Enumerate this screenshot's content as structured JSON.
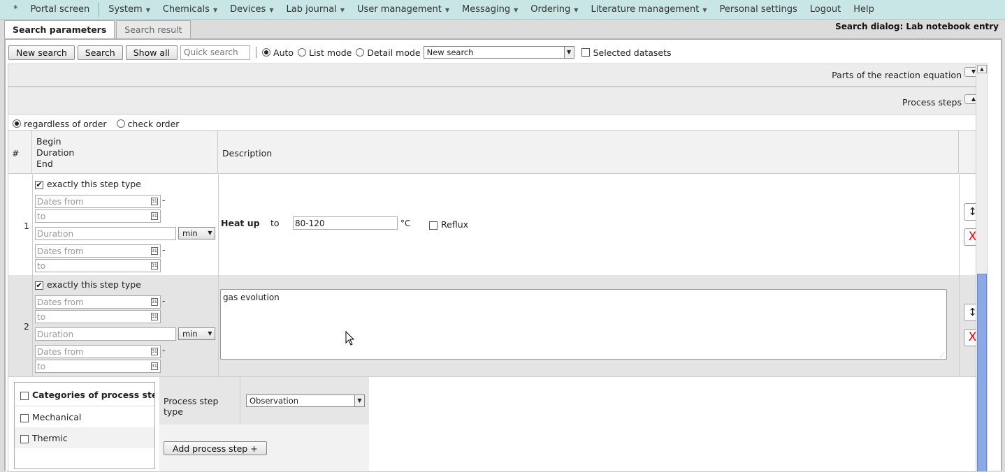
{
  "menu": {
    "items": [
      {
        "label": "*",
        "dropdown": false
      },
      {
        "label": "Portal screen",
        "dropdown": false
      },
      {
        "label": "System",
        "dropdown": true
      },
      {
        "label": "Chemicals",
        "dropdown": true
      },
      {
        "label": "Devices",
        "dropdown": true
      },
      {
        "label": "Lab journal",
        "dropdown": true
      },
      {
        "label": "User management",
        "dropdown": true
      },
      {
        "label": "Messaging",
        "dropdown": true
      },
      {
        "label": "Ordering",
        "dropdown": true
      },
      {
        "label": "Literature management",
        "dropdown": true
      },
      {
        "label": "Personal settings",
        "dropdown": false
      },
      {
        "label": "Logout",
        "dropdown": false
      },
      {
        "label": "Help",
        "dropdown": false
      }
    ]
  },
  "tabs": {
    "active": "Search parameters",
    "inactive": "Search result"
  },
  "dialog_title": "Search dialog: Lab notebook entry",
  "toolbar": {
    "new_search": "New search",
    "search": "Search",
    "show_all": "Show all",
    "quick_placeholder": "Quick search",
    "mode_auto": "Auto",
    "mode_list": "List mode",
    "mode_detail": "Detail mode",
    "preset_value": "New search",
    "selected_datasets": "Selected datasets"
  },
  "sections": {
    "reaction_parts": "Parts of the reaction equation",
    "process_steps": "Process steps"
  },
  "order": {
    "regardless": "regardless of order",
    "check": "check order"
  },
  "grid": {
    "col_num": "#",
    "col_begin": "Begin",
    "col_duration": "Duration",
    "col_end": "End",
    "col_desc": "Description"
  },
  "steps": [
    {
      "num": "1",
      "exact_label": "exactly this step type",
      "dates_from": "Dates from",
      "to": "to",
      "duration": "Duration",
      "unit": "min",
      "dash": "-",
      "heat_label": "Heat up",
      "heat_to": "to",
      "temp_value": "80-120",
      "temp_unit": "°C",
      "reflux": "Reflux"
    },
    {
      "num": "2",
      "exact_label": "exactly this step type",
      "dates_from": "Dates from",
      "to": "to",
      "duration": "Duration",
      "unit": "min",
      "dash": "-",
      "description": "gas evolution"
    }
  ],
  "icons": {
    "move": "↕",
    "delete": "X",
    "calendar": "31"
  },
  "categories": {
    "header": "Categories of process steps",
    "items": [
      "Mechanical",
      "Thermic"
    ]
  },
  "process_step_type": {
    "label": "Process step type",
    "value": "Observation"
  },
  "add_step": "Add process step +",
  "colors": {
    "menubar": "#c8e6e6",
    "scroll_thumb": "#8aa9e6",
    "delete": "#ee0000"
  }
}
